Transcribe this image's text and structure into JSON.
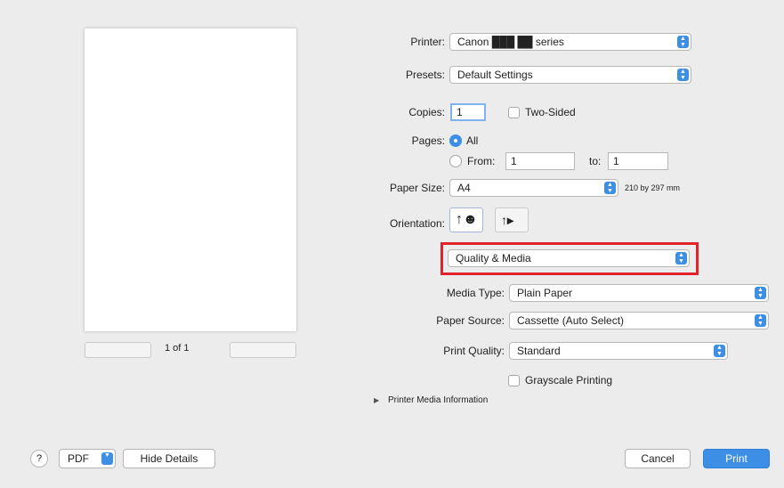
{
  "printer": {
    "label": "Printer:",
    "value": "Canon ███ ██ series"
  },
  "presets": {
    "label": "Presets:",
    "value": "Default Settings"
  },
  "copies": {
    "label": "Copies:",
    "value": "1",
    "two_sided_label": "Two-Sided",
    "two_sided_checked": false
  },
  "pages": {
    "label": "Pages:",
    "all_label": "All",
    "from_label": "From:",
    "from_value": "1",
    "to_label": "to:",
    "to_value": "1",
    "selected": "All"
  },
  "paper_size": {
    "label": "Paper Size:",
    "value": "A4",
    "dimensions": "210 by 297 mm"
  },
  "orientation": {
    "label": "Orientation:",
    "selected": "portrait"
  },
  "section": {
    "value": "Quality & Media"
  },
  "media_type": {
    "label": "Media Type:",
    "value": "Plain Paper"
  },
  "paper_source": {
    "label": "Paper Source:",
    "value": "Cassette (Auto Select)"
  },
  "print_quality": {
    "label": "Print Quality:",
    "value": "Standard"
  },
  "grayscale": {
    "label": "Grayscale Printing",
    "checked": false
  },
  "media_info": {
    "label": "Printer Media Information"
  },
  "preview": {
    "page_indicator": "1 of 1"
  },
  "footer": {
    "help": "?",
    "pdf": "PDF",
    "hide_details": "Hide Details",
    "cancel": "Cancel",
    "print": "Print"
  },
  "colors": {
    "accent": "#3d8fe6",
    "highlight": "#e0242a",
    "background": "#ececec"
  }
}
